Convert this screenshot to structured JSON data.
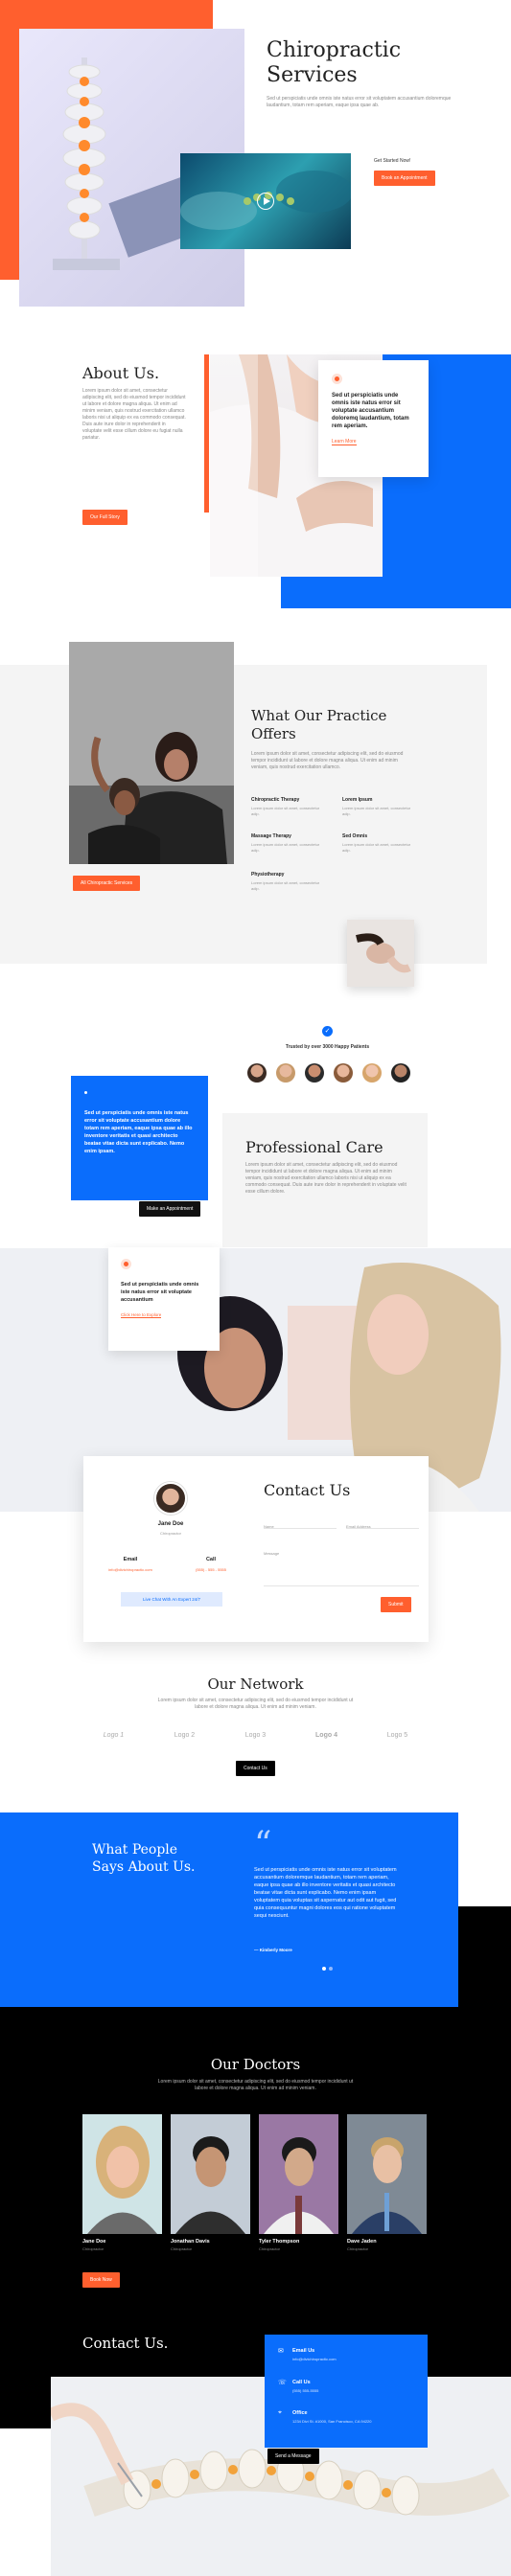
{
  "hero": {
    "title_line1": "Chiropractic",
    "title_line2": "Services",
    "text": "Sed ut perspiciatis unde omnis iste natus error sit voluptatem accusantium doloremque laudantium, totam rem aperiam, eaque ipsa quae ab.",
    "link_label": "Get Started Now!",
    "button_label": "Book an Appointment"
  },
  "about": {
    "title": "About Us.",
    "text": "Lorem ipsum dolor sit amet, consectetur adipiscing elit, sed do eiusmod tempor incididunt ut labore et dolore magna aliqua. Ut enim ad minim veniam, quis nostrud exercitation ullamco laboris nisi ut aliquip ex ea commodo consequat. Duis aute irure dolor in reprehenderit in voluptate velit esse cillum dolore eu fugiat nulla pariatur.",
    "button_label": "Our Full Story",
    "card_text": "Sed ut perspiciatis unde omnis iste natus error sit voluptate accusantium doloremq laudantium, totam rem aperiam.",
    "card_link": "Learn More"
  },
  "offers": {
    "title_line1": "What Our Practice",
    "title_line2": "Offers",
    "text": "Lorem ipsum dolor sit amet, consectetur adipiscing elit, sed do eiusmod tempor incididunt ut labore et dolore magna aliqua. Ut enim ad minim veniam, quis nostrud exercitation ullamco.",
    "button_label": "All Chiropractic Services",
    "services": [
      {
        "name": "Chiropractic Therapy",
        "text": "Lorem ipsum dolor sit amet, consectetur adip."
      },
      {
        "name": "Lorem Ipsum",
        "text": "Lorem ipsum dolor sit amet, consectetur adip."
      },
      {
        "name": "Massage Therapy",
        "text": "Lorem ipsum dolor sit amet, consectetur adip."
      },
      {
        "name": "Sed Omnis",
        "text": "Lorem ipsum dolor sit amet, consectetur adip."
      },
      {
        "name": "Physiotherapy",
        "text": "Lorem ipsum dolor sit amet, consectetur adip."
      }
    ]
  },
  "trusted": {
    "label": "Trusted by over 3000 Happy Patients"
  },
  "care": {
    "blue_text": "Sed ut perspiciatis unde omnis iste natus error sit voluptate accusantium dolore totam rem aperiam, eaque ipsa quae ab illo inventore veritatis et quasi architecto beatae vitae dicta sunt explicabo. Nemo enim ipsam.",
    "button_label": "Make an Appointment",
    "title": "Professional Care",
    "text": "Lorem ipsum dolor sit amet, consectetur adipiscing elit, sed do eiusmod tempor incididunt ut labore et dolore magna aliqua. Ut enim ad minim veniam, quis nostrud exercitation ullamco laboris nisi ut aliquip ex ea commodo consequat. Duis aute irure dolor in reprehenderit in voluptate velit esse cillum dolore."
  },
  "quote_card": {
    "text": "Sed ut perspiciatis unde omnis iste natus error sit voluptate accusantium",
    "link": "Click Here to Explore"
  },
  "contact_card": {
    "name": "Jane Doe",
    "role": "Chiropractor",
    "email_label": "Email",
    "email_value": "info@divichiropractic.com",
    "call_label": "Call",
    "call_value": "(555) - 555 - 5555",
    "button_label": "Live Chat With An Expert 24/7",
    "title": "Contact Us",
    "name_placeholder": "Name",
    "email_placeholder": "Email Address",
    "message_placeholder": "Message",
    "submit_label": "Submit"
  },
  "network": {
    "title": "Our Network",
    "text": "Lorem ipsum dolor sit amet, consectetur adipiscing elit, sed do eiusmod tempor incididunt ut labore et dolore magna aliqua. Ut enim ad minim veniam.",
    "logos": [
      "Logo 1",
      "Logo 2",
      "Logo 3",
      "Logo 4",
      "Logo 5"
    ],
    "button_label": "Contact Us"
  },
  "testimonials": {
    "title_line1": "What People",
    "title_line2": "Says About Us.",
    "quote": "Sed ut perspiciatis unde omnis iste natus error sit voluptatem accusantium doloremque laudantium, totam rem aperiam, eaque ipsa quae ab illo inventore veritatis et quasi architecto beatae vitae dicta sunt explicabo. Nemo enim ipsam voluptatem quia voluptas sit aspernatur aut odit aut fugit, sed quia consequuntur magni dolores eos qui ratione voluptatem sequi nesciunt.",
    "author": "— Kimberly Moore"
  },
  "doctors": {
    "title": "Our Doctors",
    "text": "Lorem ipsum dolor sit amet, consectetur adipiscing elit, sed do eiusmod tempor incididunt ut labore et dolore magna aliqua. Ut enim ad minim veniam.",
    "button_label": "Book Now",
    "list": [
      {
        "name": "Jane Doe",
        "role": "Chiropractor"
      },
      {
        "name": "Jonathan Davis",
        "role": "Chiropractor"
      },
      {
        "name": "Tyler Thompson",
        "role": "Chiropractor"
      },
      {
        "name": "Dave Jaden",
        "role": "Chiropractor"
      }
    ]
  },
  "contact_bottom": {
    "title": "Contact Us.",
    "email_label": "Email Us",
    "email_value": "info@divichiropractic.com",
    "call_label": "Call Us",
    "call_value": "(555) 555-5555",
    "office_label": "Office",
    "office_value": "1234 Divi St. #1000, San Francisco, CA 94220",
    "button_label": "Send a Message"
  },
  "colors": {
    "orange": "#ff5f2e",
    "blue": "#0a6dfc",
    "black": "#000000"
  }
}
